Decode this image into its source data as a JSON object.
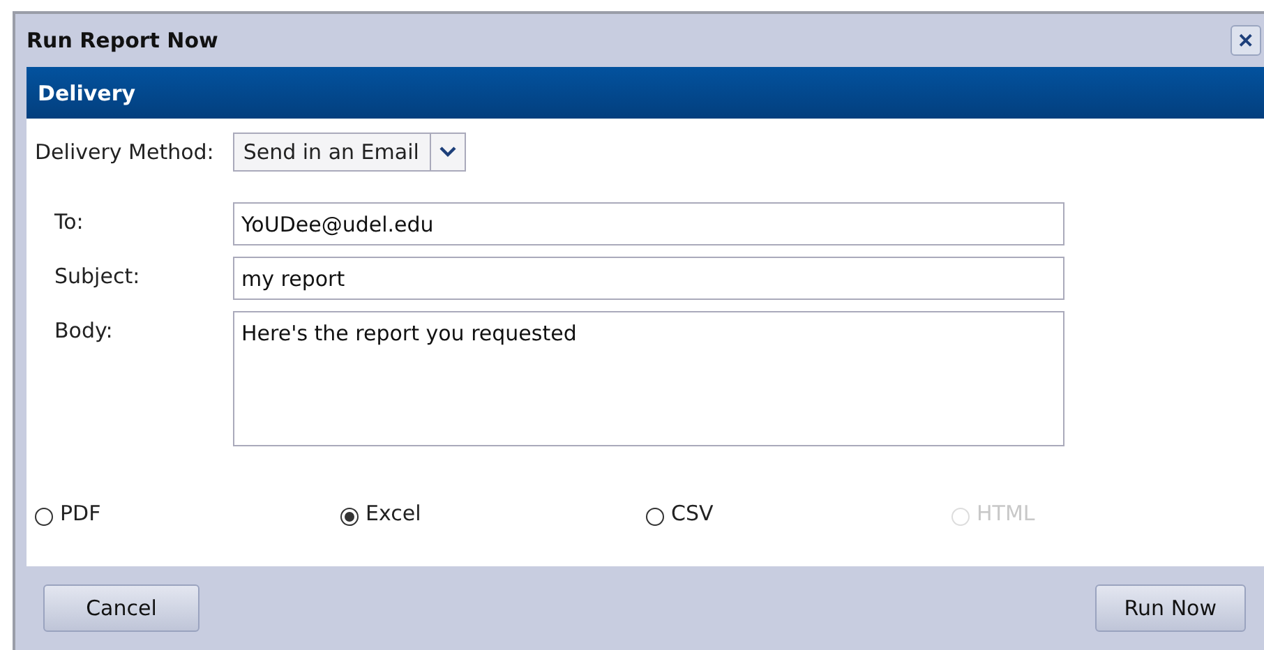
{
  "window": {
    "title": "Run Report Now",
    "close": "✕"
  },
  "section": {
    "title": "Delivery"
  },
  "delivery_method": {
    "label": "Delivery Method:",
    "value": "Send in an Email"
  },
  "fields": [
    {
      "label": "To:",
      "value": "YoUDee@udel.edu",
      "kind": "input"
    },
    {
      "label": "Subject:",
      "value": "my report",
      "kind": "input"
    },
    {
      "label": "Body:",
      "value": "Here's the report you requested",
      "kind": "textarea"
    }
  ],
  "formats": [
    {
      "label": "PDF",
      "selected": false,
      "disabled": false
    },
    {
      "label": "Excel",
      "selected": true,
      "disabled": false
    },
    {
      "label": "CSV",
      "selected": false,
      "disabled": false
    },
    {
      "label": "HTML",
      "selected": false,
      "disabled": true
    }
  ],
  "buttons": [
    {
      "label": "Cancel"
    },
    {
      "label": "Run Now"
    }
  ]
}
